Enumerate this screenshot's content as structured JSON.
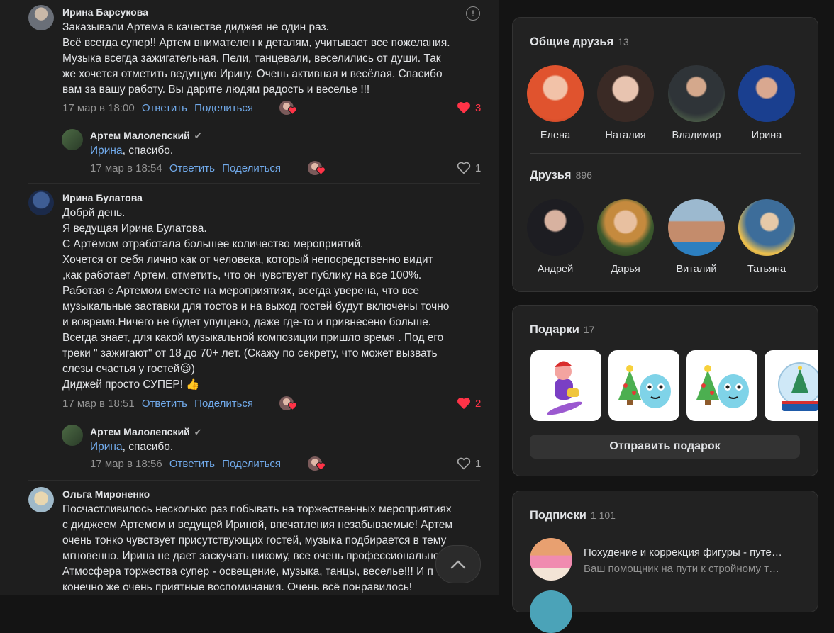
{
  "comments": [
    {
      "author": "Ирина Барсукова",
      "lines": [
        "Заказывали Артема в качестве диджея не один раз.",
        "Всё всегда супер!! Артем внимателен к деталям, учитывает все пожелания.",
        "Музыка всегда зажигательная. Пели, танцевали, веселились от души. Так",
        "же хочется отметить ведущую Ирину. Очень активная и весёлая. Спасибо",
        "вам за вашу работу. Вы дарите людям радость и веселье !!!"
      ],
      "date": "17 мар в 18:00",
      "reply_label": "Ответить",
      "share_label": "Поделиться",
      "likes": "3"
    },
    {
      "author": "Ирина Булатова",
      "lines": [
        "Добрй день.",
        "Я ведущая Ирина Булатова.",
        "С Артёмом отработала большее количество мероприятий.",
        "Хочется от себя лично как от человека, который непосредственно видит",
        ",как работает Артем, отметить, что он чувствует публику на все 100%.",
        "Работая с Артемом вместе на мероприятиях, всегда уверена, что все",
        "музыкальные заставки для тостов и на выход гостей будут включены точно",
        "и вовремя.Ничего не будет упущено, даже где-то и привнесено больше.",
        "Всегда знает, для какой музыкальной композиции пришло время . Под его",
        "треки \" зажигают\" от 18 до 70+ лет. (Скажу по секрету, что может вызвать",
        "слезы счастья у гостей😉)",
        "Диджей просто СУПЕР! 👍"
      ],
      "date": "17 мар в 18:51",
      "reply_label": "Ответить",
      "share_label": "Поделиться",
      "likes": "2"
    },
    {
      "author": "Ольга Мироненко",
      "lines": [
        "Посчастливилось несколько раз побывать на торжественных мероприятиях",
        "с диджеем Артемом и ведущей Ириной, впечатления незабываемые! Артем",
        "очень тонко чувствует присутствующих гостей, музыка подбирается в тему",
        "мгновенно. Ирина не дает заскучать никому, все очень профессионально.",
        "Атмосфера торжества супер - освещение, музыка, танцы, веселье!!! И п",
        "конечно же очень приятные воспоминания. Очень всё понравилось!"
      ]
    }
  ],
  "replies": [
    {
      "author": "Артем Малолепский",
      "mention": "Ирина",
      "text": ", спасибо.",
      "date": "17 мар в 18:54",
      "reply_label": "Ответить",
      "share_label": "Поделиться",
      "likes": "1"
    },
    {
      "author": "Артем Малолепский",
      "mention": "Ирина",
      "text": ", спасибо.",
      "date": "17 мар в 18:56",
      "reply_label": "Ответить",
      "share_label": "Поделиться",
      "likes": "1"
    }
  ],
  "mutual_friends": {
    "title": "Общие друзья",
    "count": "13",
    "people": [
      "Елена",
      "Наталия",
      "Владимир",
      "Ирина"
    ]
  },
  "friends": {
    "title": "Друзья",
    "count": "896",
    "people": [
      "Андрей",
      "Дарья",
      "Виталий",
      "Татьяна"
    ]
  },
  "gifts": {
    "title": "Подарки",
    "count": "17",
    "send_label": "Отправить подарок"
  },
  "subscriptions": {
    "title": "Подписки",
    "count": "1 101",
    "items": [
      {
        "title": "Похудение и коррекция фигуры - путе…",
        "desc": "Ваш помощник на пути к стройному т…"
      }
    ]
  },
  "colors": {
    "accent": "#71aaeb",
    "like_active": "#ff3347",
    "background": "#1e1e1e"
  }
}
